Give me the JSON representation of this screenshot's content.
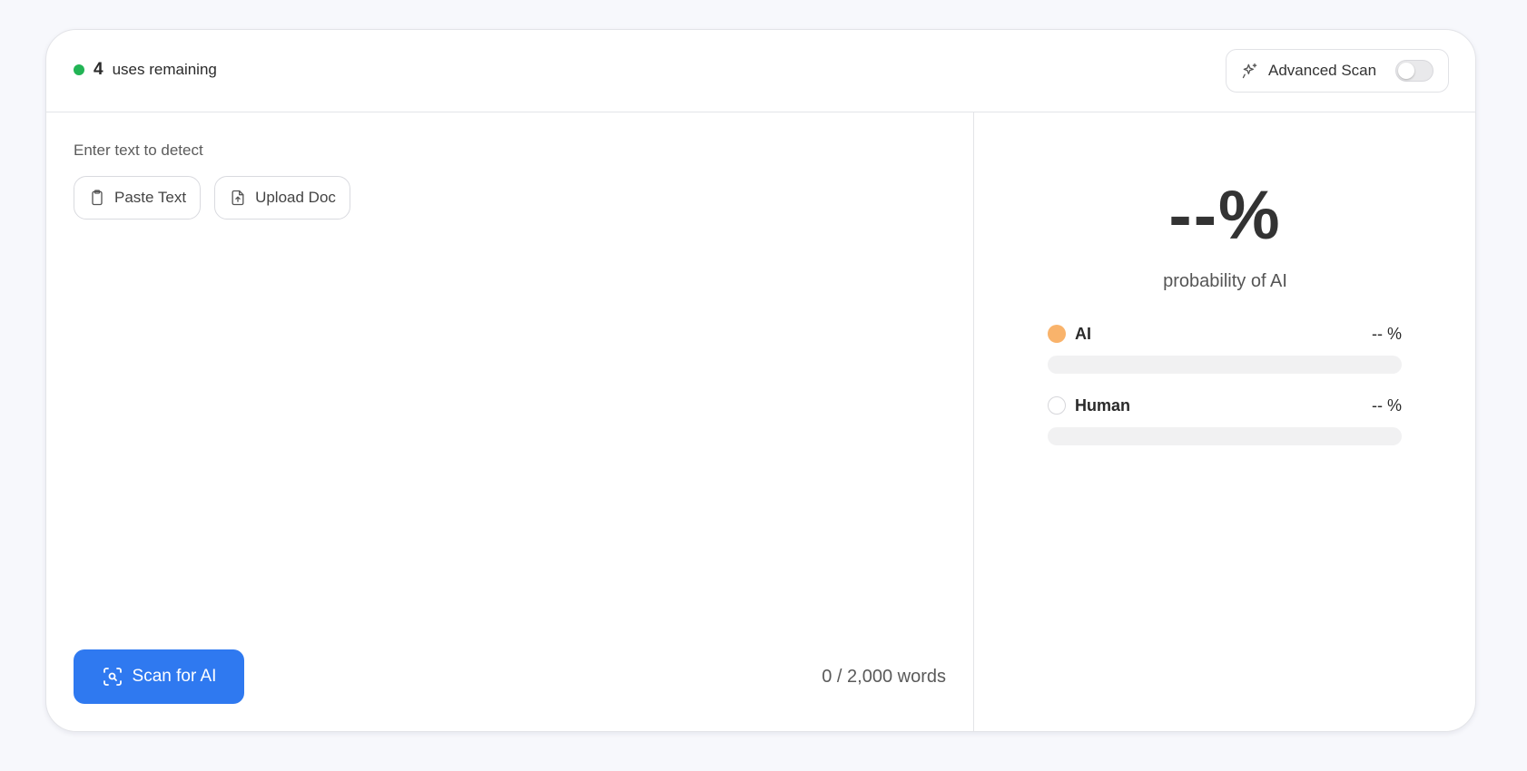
{
  "header": {
    "uses_count": "4",
    "uses_label": "uses remaining",
    "status_color": "#22b455",
    "advanced_scan": {
      "label": "Advanced Scan",
      "icon": "sparkles-icon",
      "enabled": false
    }
  },
  "input_panel": {
    "prompt": "Enter text to detect",
    "buttons": [
      {
        "label": "Paste Text",
        "icon": "clipboard-icon"
      },
      {
        "label": "Upload Doc",
        "icon": "file-upload-icon"
      }
    ],
    "scan_button": {
      "label": "Scan for AI",
      "icon": "scan-search-icon",
      "color": "#2f79f0"
    },
    "word_count": "0 / 2,000 words"
  },
  "results": {
    "headline_value": "--%",
    "headline_label": "probability of AI",
    "metrics": [
      {
        "name": "AI",
        "value": "-- %",
        "dot_color": "#f9b36b",
        "fill": 0
      },
      {
        "name": "Human",
        "value": "-- %",
        "dot_color": "#ffffff",
        "fill": 0
      }
    ]
  }
}
